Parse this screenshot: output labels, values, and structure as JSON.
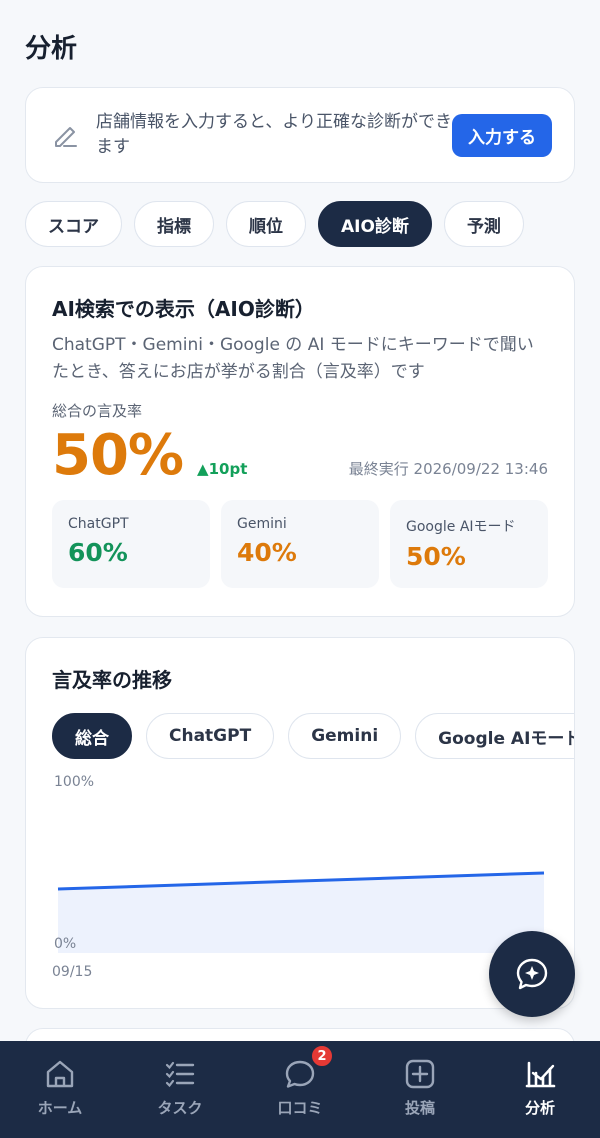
{
  "page": {
    "title": "分析"
  },
  "store_prompt": {
    "text": "店舗情報を入力すると、より正確な診断ができます",
    "button_label": "入力する"
  },
  "tabs": [
    {
      "label": "スコア",
      "active": false
    },
    {
      "label": "指標",
      "active": false
    },
    {
      "label": "順位",
      "active": false
    },
    {
      "label": "AIO診断",
      "active": true
    },
    {
      "label": "予測",
      "active": false
    }
  ],
  "aio": {
    "title": "AI検索での表示（AIO診断）",
    "description": "ChatGPT・Gemini・Google の AI モードにキーワードで聞いたとき、答えにお店が挙がる割合（言及率）です",
    "overall_label": "総合の言及率",
    "overall_value": "50%",
    "delta": "▲10pt",
    "last_run": "最終実行 2026/09/22 13:46",
    "engines": [
      {
        "name": "ChatGPT",
        "value": "60%",
        "color": "#13935a"
      },
      {
        "name": "Gemini",
        "value": "40%",
        "color": "#dd7a0b"
      },
      {
        "name": "Google AIモード",
        "value": "50%",
        "color": "#dd7a0b"
      }
    ]
  },
  "trend": {
    "title": "言及率の推移",
    "chips": [
      {
        "label": "総合",
        "active": true
      },
      {
        "label": "ChatGPT",
        "active": false
      },
      {
        "label": "Gemini",
        "active": false
      },
      {
        "label": "Google AIモード",
        "active": false
      }
    ]
  },
  "chart_data": {
    "type": "area",
    "x": [
      "09/15",
      "09/22"
    ],
    "x_tick_labels": [
      "09/15"
    ],
    "series": [
      {
        "values": [
          40,
          50
        ]
      }
    ],
    "ylim": [
      0,
      100
    ],
    "y_tick_labels": [
      "100%",
      "0%"
    ],
    "line_color": "#2466e8",
    "fill_color": "#edf2fd"
  },
  "nav": {
    "items": [
      {
        "label": "ホーム",
        "icon": "home-icon",
        "active": false
      },
      {
        "label": "タスク",
        "icon": "task-list-icon",
        "active": false
      },
      {
        "label": "口コミ",
        "icon": "chat-bubble-icon",
        "active": false,
        "badge": "2"
      },
      {
        "label": "投稿",
        "icon": "plus-square-icon",
        "active": false
      },
      {
        "label": "分析",
        "icon": "chart-icon",
        "active": true
      }
    ]
  }
}
